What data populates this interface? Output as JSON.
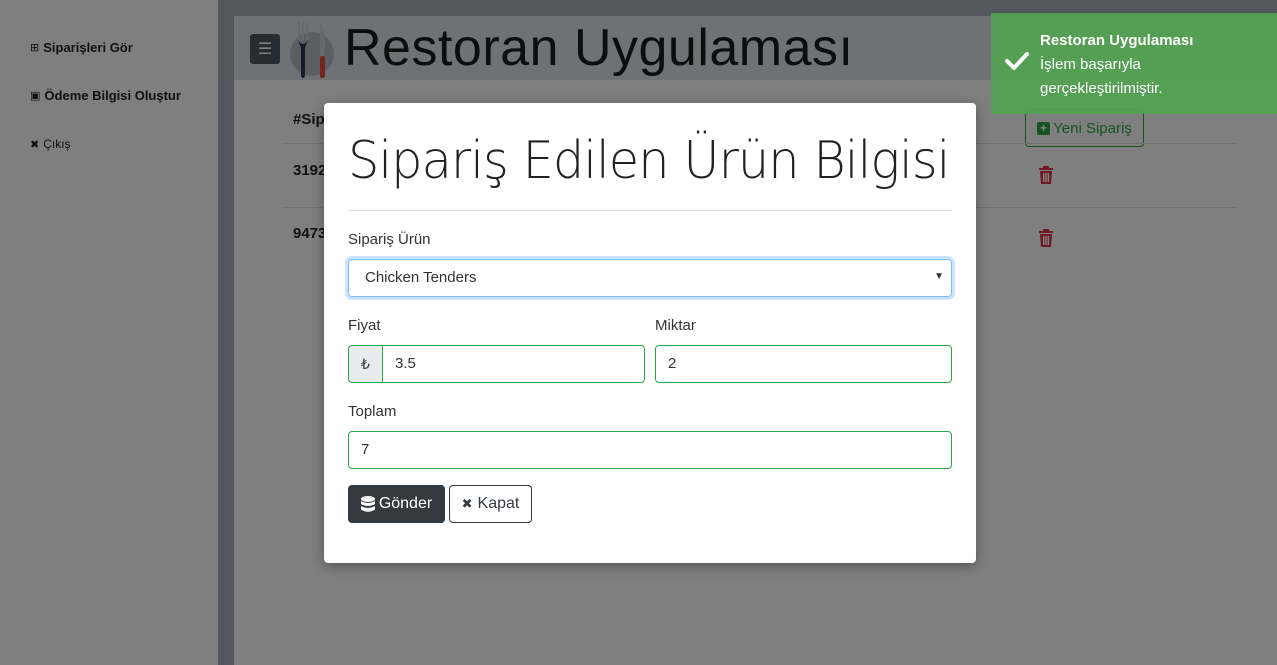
{
  "sidebar": {
    "items": [
      {
        "icon": "table-icon",
        "glyph": "⊞",
        "label": "Siparişleri Gör"
      },
      {
        "icon": "save-icon",
        "glyph": "🖫",
        "label": "Ödeme Bilgisi Oluştur"
      },
      {
        "icon": "close-icon",
        "glyph": "✖",
        "label": "Çıkış"
      }
    ]
  },
  "header": {
    "title": "Restoran Uygulaması",
    "menu_icon": "☰"
  },
  "table": {
    "header_partial": "#Sip",
    "rows": [
      {
        "id_partial": "3192"
      },
      {
        "id_partial": "9473"
      }
    ],
    "new_order_label": "Yeni Sipariş"
  },
  "toast": {
    "title": "Restoran Uygulaması",
    "message": "İşlem başarıyla gerçekleştirilmiştir.",
    "color": "#51a351"
  },
  "modal": {
    "title": "Sipariş Edilen Ürün Bilgisi",
    "product_label": "Sipariş Ürün",
    "product_value": "Chicken Tenders",
    "price_label": "Fiyat",
    "currency_symbol": "₺",
    "price_value": "3.5",
    "qty_label": "Miktar",
    "qty_value": "2",
    "total_label": "Toplam",
    "total_value": "7",
    "send_label": "Gönder",
    "close_label": "Kapat"
  }
}
